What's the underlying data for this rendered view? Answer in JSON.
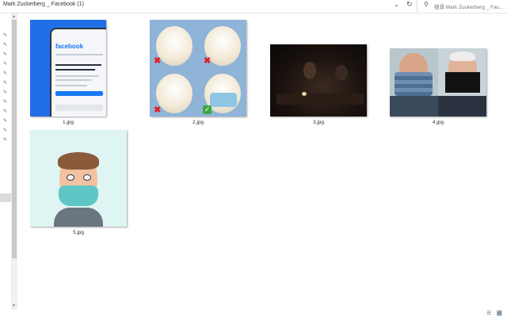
{
  "address_bar": {
    "path": "Mark Zuckerberg _ Facebook (1)",
    "chevron_icon": "chevron-down-icon",
    "refresh_icon": "refresh-icon"
  },
  "search": {
    "placeholder": "搜尋 Mark Zuckerberg _ Fac...",
    "icon": "search-icon"
  },
  "files": [
    {
      "name": "1.jpg",
      "content": "facebook-phone-screenshot"
    },
    {
      "name": "2.jpg",
      "content": "dog-mask-collage"
    },
    {
      "name": "3.jpg",
      "content": "dim-restaurant-photo"
    },
    {
      "name": "4.jpg",
      "content": "two-men-in-masks"
    },
    {
      "name": "5.jpg",
      "content": "avatar-with-mask"
    }
  ],
  "thumb1": {
    "logo": "facebook"
  },
  "status_bar": {
    "view_icons": [
      "details-view-icon",
      "large-icons-view-icon"
    ]
  },
  "colors": {
    "facebook_blue": "#1877f2",
    "thumb_bg_blue": "#1f6fe6",
    "mask_teal": "#5ec6c4",
    "selected_view": "#cce4f7"
  }
}
